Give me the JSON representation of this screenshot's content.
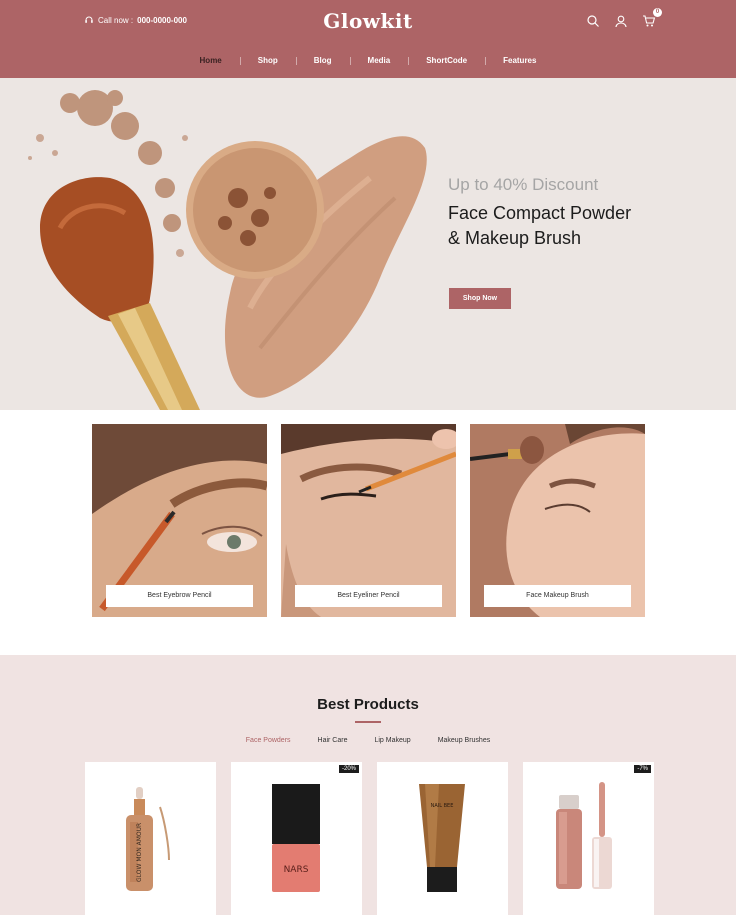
{
  "header": {
    "call_label": "Call now :",
    "call_number": "000-0000-000",
    "logo": "Glowkit",
    "cart_count": "0",
    "nav": [
      "Home",
      "Shop",
      "Blog",
      "Media",
      "ShortCode",
      "Features"
    ]
  },
  "hero": {
    "subtitle": "Up to 40% Discount",
    "title_line1": "Face Compact Powder",
    "title_line2": "& Makeup Brush",
    "button": "Shop Now"
  },
  "categories": [
    "Best Eyebrow Pencil",
    "Best Eyeliner Pencil",
    "Face Makeup Brush"
  ],
  "products": {
    "title": "Best Products",
    "tabs": [
      "Face Powders",
      "Hair Care",
      "Lip Makeup",
      "Makeup Brushes"
    ],
    "items": [
      {
        "badge": "",
        "image": "serum-dropper-bottle"
      },
      {
        "badge": "-20%",
        "image": "nail-polish-bottle"
      },
      {
        "badge": "",
        "image": "cream-tube"
      },
      {
        "badge": "-7%",
        "image": "lip-gloss"
      }
    ]
  },
  "colors": {
    "accent": "#ad6466",
    "hero_bg": "#ece6e3",
    "products_bg": "#f0e3e2"
  }
}
